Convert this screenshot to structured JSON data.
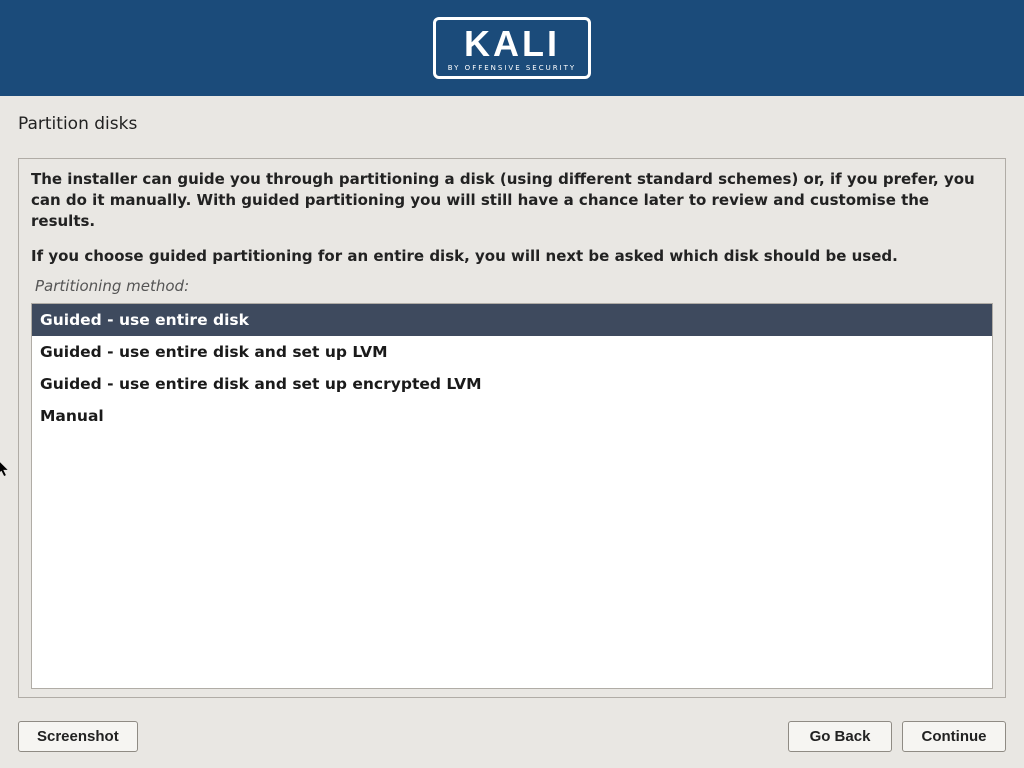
{
  "header": {
    "logo_text": "KALI",
    "logo_sub": "BY OFFENSIVE SECURITY"
  },
  "page": {
    "title": "Partition disks",
    "description1": "The installer can guide you through partitioning a disk (using different standard schemes) or, if you prefer, you can do it manually. With guided partitioning you will still have a chance later to review and customise the results.",
    "description2": "If you choose guided partitioning for an entire disk, you will next be asked which disk should be used.",
    "label": "Partitioning method:"
  },
  "options": [
    "Guided - use entire disk",
    "Guided - use entire disk and set up LVM",
    "Guided - use entire disk and set up encrypted LVM",
    "Manual"
  ],
  "selected_index": 0,
  "footer": {
    "screenshot": "Screenshot",
    "goback": "Go Back",
    "continue": "Continue"
  }
}
